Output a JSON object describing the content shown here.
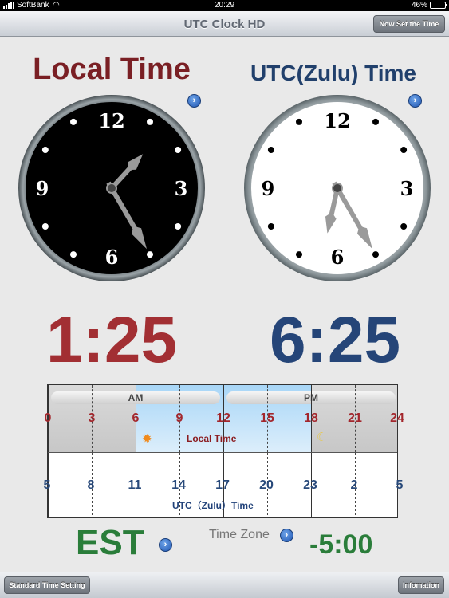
{
  "status_bar": {
    "carrier": "SoftBank",
    "time": "20:29",
    "battery": "46%",
    "battery_level": 0.46
  },
  "nav": {
    "title": "UTC Clock HD",
    "set_time_label": "Now Set the Time"
  },
  "local": {
    "title": "Local Time",
    "digital": "1:25",
    "hour": 1,
    "minute": 25
  },
  "utc": {
    "title": "UTC(Zulu) Time",
    "digital": "6:25",
    "hour": 6,
    "minute": 25
  },
  "clock_numerals": [
    "12",
    "3",
    "6",
    "9"
  ],
  "timeline": {
    "am_label": "AM",
    "pm_label": "PM",
    "local_label": "Local Time",
    "utc_label": "UTC（Zulu）Time",
    "local_hours": [
      "0",
      "3",
      "6",
      "9",
      "12",
      "15",
      "18",
      "21",
      "24"
    ],
    "utc_hours": [
      "5",
      "8",
      "11",
      "14",
      "17",
      "20",
      "23",
      "2",
      "5"
    ]
  },
  "timezone": {
    "name": "EST",
    "label": "Time Zone",
    "offset": "-5:00"
  },
  "toolbar": {
    "standard_label": "Standard Time Setting",
    "info_label": "Infomation"
  },
  "colors": {
    "local": "#a22f33",
    "utc": "#254578",
    "zone": "#2a7d3a",
    "day_sky": "#a8d6f7"
  }
}
